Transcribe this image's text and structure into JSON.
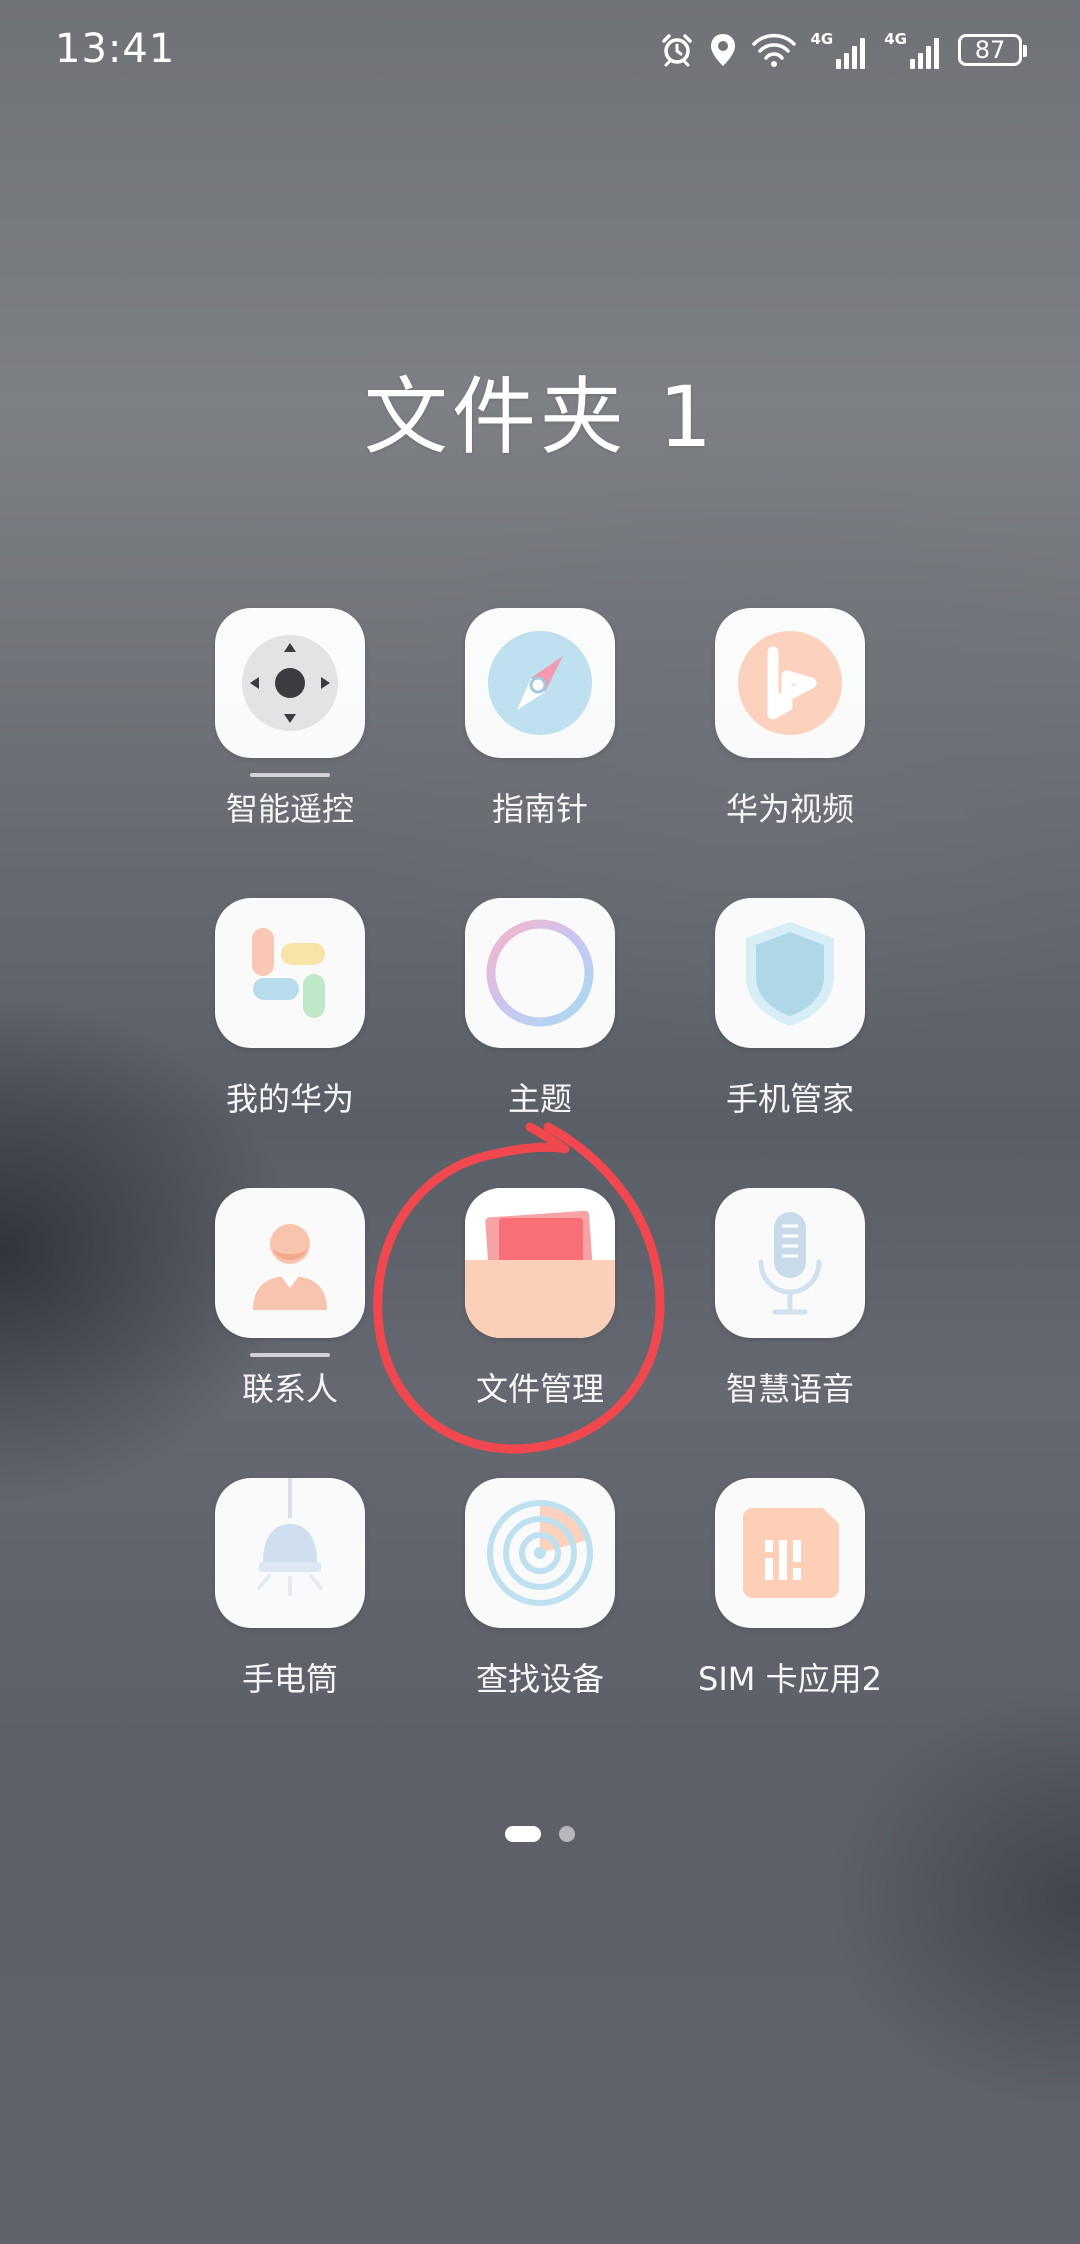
{
  "status_bar": {
    "time": "13:41",
    "network_1": "4G",
    "network_2": "4G",
    "battery": "87",
    "icons": [
      "alarm-icon",
      "location-icon",
      "wifi-icon",
      "signal-icon",
      "signal-icon",
      "battery-icon"
    ]
  },
  "folder": {
    "title": "文件夹 1"
  },
  "apps": [
    {
      "label": "智能遥控",
      "icon": "remote-control-icon"
    },
    {
      "label": "指南针",
      "icon": "compass-icon"
    },
    {
      "label": "华为视频",
      "icon": "video-play-icon"
    },
    {
      "label": "我的华为",
      "icon": "my-huawei-icon"
    },
    {
      "label": "主题",
      "icon": "theme-ring-icon"
    },
    {
      "label": "手机管家",
      "icon": "shield-icon"
    },
    {
      "label": "联系人",
      "icon": "contact-person-icon"
    },
    {
      "label": "文件管理",
      "icon": "folder-files-icon"
    },
    {
      "label": "智慧语音",
      "icon": "microphone-icon"
    },
    {
      "label": "手电筒",
      "icon": "flashlight-icon"
    },
    {
      "label": "查找设备",
      "icon": "radar-icon"
    },
    {
      "label": "SIM 卡应用2",
      "icon": "sim-card-icon"
    }
  ],
  "pagination": {
    "total_pages": 2,
    "current_page": 1
  },
  "colors": {
    "annotation_circle": "#f0484e",
    "icon_background": "#ffffff"
  }
}
